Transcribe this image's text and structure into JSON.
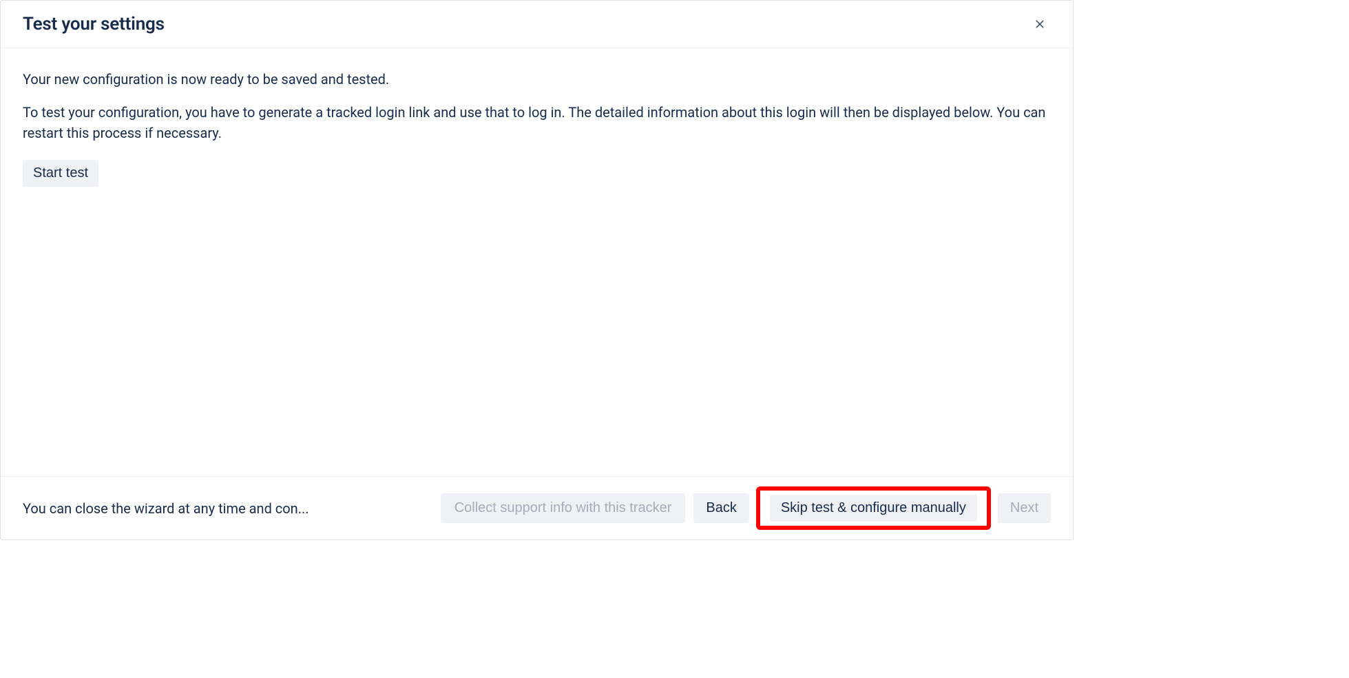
{
  "header": {
    "title": "Test your settings"
  },
  "body": {
    "intro": "Your new configuration is now ready to be saved and tested.",
    "instructions": "To test your configuration, you have to generate a tracked login link and use that to log in. The detailed information about this login will then be displayed below. You can restart this process if necessary.",
    "start_test_label": "Start test"
  },
  "footer": {
    "note": "You can close the wizard at any time and con...",
    "collect_support_label": "Collect support info with this tracker",
    "back_label": "Back",
    "skip_label": "Skip test & configure manually",
    "next_label": "Next"
  }
}
